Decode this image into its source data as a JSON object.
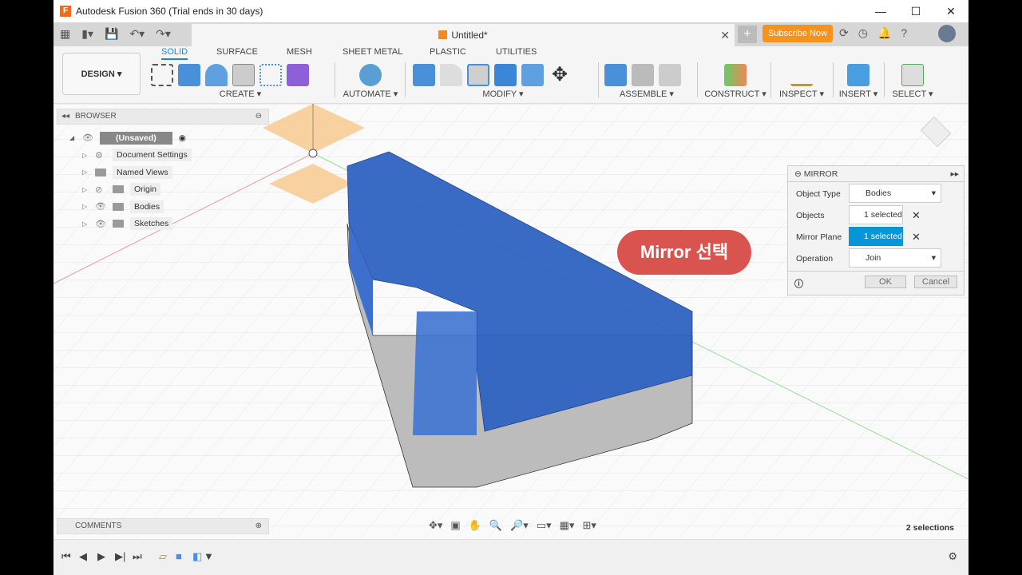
{
  "window": {
    "title": "Autodesk Fusion 360 (Trial ends in 30 days)",
    "minimize": "—",
    "maximize": "☐",
    "close": "✕"
  },
  "document": {
    "tab_title": "Untitled*",
    "close": "✕",
    "new_tab": "+"
  },
  "quickbar": {
    "subscribe": "Subscribe Now"
  },
  "ribbon": {
    "workspace": "DESIGN ▾",
    "tabs": [
      "SOLID",
      "SURFACE",
      "MESH",
      "SHEET METAL",
      "PLASTIC",
      "UTILITIES"
    ],
    "groups": [
      "CREATE ▾",
      "AUTOMATE ▾",
      "MODIFY ▾",
      "ASSEMBLE ▾",
      "CONSTRUCT ▾",
      "INSPECT ▾",
      "INSERT ▾",
      "SELECT ▾"
    ]
  },
  "browser": {
    "title": "BROWSER",
    "root": "(Unsaved)",
    "items": [
      "Document Settings",
      "Named Views",
      "Origin",
      "Bodies",
      "Sketches"
    ]
  },
  "comments": {
    "title": "COMMENTS"
  },
  "mirror": {
    "title": "MIRROR",
    "rows": [
      {
        "label": "Object Type",
        "value": "Bodies"
      },
      {
        "label": "Objects",
        "value": "1 selected"
      },
      {
        "label": "Mirror Plane",
        "value": "1 selected"
      },
      {
        "label": "Operation",
        "value": "Join"
      }
    ],
    "ok": "OK",
    "cancel": "Cancel"
  },
  "callout": "Mirror 선택",
  "status": {
    "selections": "2 selections"
  },
  "colors": {
    "accent": "#0696d7",
    "body": "#2f63c2",
    "callout": "#d9534f",
    "subscribe": "#f6921e"
  }
}
